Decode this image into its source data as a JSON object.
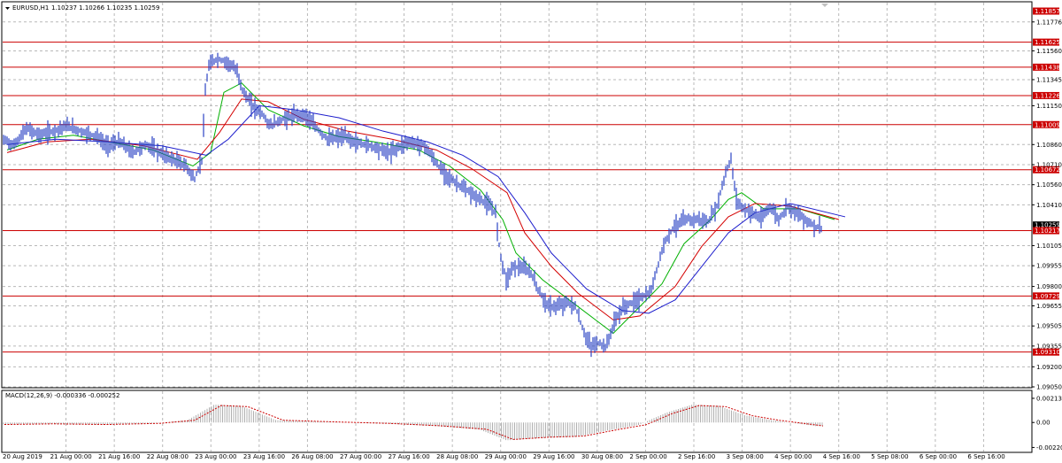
{
  "chart_header": {
    "symbol_timeframe": "EURUSD,H1",
    "ohlc": "1.10237 1.10266 1.10235 1.10259"
  },
  "indicator_header": {
    "label": "MACD(12,26,9) -0.000336 -0.000252"
  },
  "colors": {
    "candles": "#2b44c4",
    "level_lines": "#cc0000",
    "ma_fast": "#00b000",
    "ma_mid": "#d40000",
    "ma_slow": "#1c1ccc",
    "macd_hist": "#b0b0b0",
    "macd_signal": "#cc0000",
    "grid": "#b8b8b8"
  },
  "chart_data": {
    "type": "candlestick",
    "symbol": "EURUSD",
    "timeframe": "H1",
    "ylim": [
      1.0905,
      1.1192
    ],
    "y_ticks": [
      "1.11776",
      "1.11560",
      "1.11345",
      "1.11150",
      "1.10860",
      "1.10710",
      "1.10560",
      "1.10410",
      "1.10105",
      "1.09955",
      "1.09800",
      "1.09655",
      "1.09505",
      "1.09355",
      "1.09200",
      "1.09050"
    ],
    "x_ticks": [
      "20 Aug 2019",
      "21 Aug 00:00",
      "21 Aug 16:00",
      "22 Aug 08:00",
      "23 Aug 00:00",
      "23 Aug 16:00",
      "26 Aug 08:00",
      "27 Aug 00:00",
      "27 Aug 16:00",
      "28 Aug 08:00",
      "29 Aug 00:00",
      "29 Aug 16:00",
      "30 Aug 08:00",
      "2 Sep 00:00",
      "2 Sep 16:00",
      "3 Sep 08:00",
      "4 Sep 00:00",
      "4 Sep 16:00",
      "5 Sep 08:00",
      "6 Sep 00:00",
      "6 Sep 16:00"
    ],
    "levels": [
      {
        "label": "1.11857",
        "value": 1.11857,
        "line": false
      },
      {
        "label": "1.11625",
        "value": 1.11625,
        "line": true
      },
      {
        "label": "1.11438",
        "value": 1.11438,
        "line": true
      },
      {
        "label": "1.11226",
        "value": 1.11226,
        "line": true
      },
      {
        "label": "1.11009",
        "value": 1.11009,
        "line": true
      },
      {
        "label": "1.10672",
        "value": 1.10672,
        "line": true
      },
      {
        "label": "1.10259",
        "value": 1.10259,
        "line": false
      },
      {
        "label": "1.10217",
        "value": 1.10217,
        "line": true
      },
      {
        "label": "1.09729",
        "value": 1.09729,
        "line": true
      },
      {
        "label": "1.09310",
        "value": 1.0931,
        "line": true
      }
    ],
    "price_path": [
      [
        0,
        1.1083
      ],
      [
        5,
        1.109
      ],
      [
        15,
        1.1085
      ],
      [
        30,
        1.1098
      ],
      [
        45,
        1.1093
      ],
      [
        60,
        1.1096
      ],
      [
        75,
        1.11
      ],
      [
        95,
        1.1095
      ],
      [
        110,
        1.1092
      ],
      [
        120,
        1.1085
      ],
      [
        135,
        1.1088
      ],
      [
        150,
        1.108
      ],
      [
        165,
        1.1086
      ],
      [
        180,
        1.108
      ],
      [
        195,
        1.1075
      ],
      [
        210,
        1.107
      ],
      [
        220,
        1.106
      ],
      [
        228,
        1.1075
      ],
      [
        232,
        1.1125
      ],
      [
        236,
        1.1145
      ],
      [
        245,
        1.115
      ],
      [
        255,
        1.1148
      ],
      [
        262,
        1.1145
      ],
      [
        268,
        1.114
      ],
      [
        275,
        1.1125
      ],
      [
        285,
        1.1115
      ],
      [
        295,
        1.111
      ],
      [
        305,
        1.11
      ],
      [
        320,
        1.1105
      ],
      [
        335,
        1.1108
      ],
      [
        345,
        1.1108
      ],
      [
        355,
        1.11
      ],
      [
        370,
        1.109
      ],
      [
        390,
        1.1092
      ],
      [
        400,
        1.1088
      ],
      [
        420,
        1.1085
      ],
      [
        440,
        1.108
      ],
      [
        460,
        1.1088
      ],
      [
        480,
        1.1085
      ],
      [
        495,
        1.107
      ],
      [
        510,
        1.106
      ],
      [
        520,
        1.1055
      ],
      [
        535,
        1.1048
      ],
      [
        550,
        1.1042
      ],
      [
        560,
        1.1035
      ],
      [
        565,
        1.1005
      ],
      [
        572,
        1.0985
      ],
      [
        580,
        1.0995
      ],
      [
        590,
        1.0994
      ],
      [
        600,
        1.099
      ],
      [
        610,
        1.0975
      ],
      [
        620,
        1.0965
      ],
      [
        630,
        1.0965
      ],
      [
        640,
        1.0968
      ],
      [
        650,
        1.0965
      ],
      [
        660,
        1.0945
      ],
      [
        668,
        1.0935
      ],
      [
        675,
        1.0938
      ],
      [
        685,
        1.0935
      ],
      [
        695,
        1.0955
      ],
      [
        705,
        1.0965
      ],
      [
        715,
        1.0968
      ],
      [
        725,
        1.0972
      ],
      [
        735,
        1.0975
      ],
      [
        745,
        1.1
      ],
      [
        752,
        1.1015
      ],
      [
        762,
        1.1025
      ],
      [
        775,
        1.103
      ],
      [
        790,
        1.103
      ],
      [
        800,
        1.1028
      ],
      [
        810,
        1.104
      ],
      [
        820,
        1.1065
      ],
      [
        826,
        1.1075
      ],
      [
        832,
        1.1045
      ],
      [
        840,
        1.1038
      ],
      [
        850,
        1.1035
      ],
      [
        860,
        1.103
      ],
      [
        870,
        1.104
      ],
      [
        880,
        1.103
      ],
      [
        890,
        1.104
      ],
      [
        900,
        1.1035
      ],
      [
        910,
        1.103
      ],
      [
        920,
        1.1025
      ],
      [
        928,
        1.1024
      ]
    ],
    "moving_averages": [
      {
        "color_key": "ma_fast",
        "points": [
          [
            5,
            1.1082
          ],
          [
            40,
            1.109
          ],
          [
            80,
            1.1093
          ],
          [
            120,
            1.1088
          ],
          [
            170,
            1.1082
          ],
          [
            215,
            1.107
          ],
          [
            235,
            1.108
          ],
          [
            250,
            1.1125
          ],
          [
            270,
            1.1132
          ],
          [
            300,
            1.1112
          ],
          [
            340,
            1.11
          ],
          [
            380,
            1.1092
          ],
          [
            420,
            1.1088
          ],
          [
            470,
            1.1082
          ],
          [
            505,
            1.107
          ],
          [
            540,
            1.1052
          ],
          [
            565,
            1.103
          ],
          [
            580,
            1.1005
          ],
          [
            610,
            1.0985
          ],
          [
            640,
            1.097
          ],
          [
            670,
            1.0955
          ],
          [
            690,
            1.0945
          ],
          [
            720,
            1.0965
          ],
          [
            745,
            1.0982
          ],
          [
            770,
            1.1012
          ],
          [
            800,
            1.103
          ],
          [
            820,
            1.1045
          ],
          [
            835,
            1.105
          ],
          [
            860,
            1.1038
          ],
          [
            900,
            1.1038
          ],
          [
            940,
            1.103
          ]
        ]
      },
      {
        "color_key": "ma_mid",
        "points": [
          [
            5,
            1.108
          ],
          [
            50,
            1.1088
          ],
          [
            100,
            1.109
          ],
          [
            160,
            1.1085
          ],
          [
            220,
            1.1075
          ],
          [
            245,
            1.1095
          ],
          [
            270,
            1.112
          ],
          [
            300,
            1.1118
          ],
          [
            340,
            1.1105
          ],
          [
            390,
            1.1096
          ],
          [
            440,
            1.109
          ],
          [
            490,
            1.1082
          ],
          [
            530,
            1.1068
          ],
          [
            570,
            1.105
          ],
          [
            590,
            1.102
          ],
          [
            620,
            1.0995
          ],
          [
            650,
            1.0975
          ],
          [
            690,
            1.0955
          ],
          [
            720,
            1.0958
          ],
          [
            760,
            1.098
          ],
          [
            790,
            1.101
          ],
          [
            820,
            1.1032
          ],
          [
            850,
            1.1042
          ],
          [
            890,
            1.104
          ],
          [
            945,
            1.103
          ]
        ]
      },
      {
        "color_key": "ma_slow",
        "points": [
          [
            5,
            1.1086
          ],
          [
            60,
            1.109
          ],
          [
            120,
            1.1088
          ],
          [
            180,
            1.1085
          ],
          [
            230,
            1.1078
          ],
          [
            255,
            1.109
          ],
          [
            290,
            1.1115
          ],
          [
            330,
            1.1112
          ],
          [
            380,
            1.1106
          ],
          [
            430,
            1.1096
          ],
          [
            480,
            1.1088
          ],
          [
            520,
            1.1078
          ],
          [
            560,
            1.1062
          ],
          [
            590,
            1.1035
          ],
          [
            620,
            1.1005
          ],
          [
            660,
            1.0978
          ],
          [
            700,
            1.0962
          ],
          [
            730,
            1.096
          ],
          [
            760,
            1.097
          ],
          [
            790,
            1.0995
          ],
          [
            820,
            1.102
          ],
          [
            850,
            1.1035
          ],
          [
            890,
            1.1042
          ],
          [
            952,
            1.1032
          ]
        ]
      }
    ],
    "macd": {
      "ylim": [
        -0.00225,
        0.00213
      ],
      "y_ticks": [
        "0.002134",
        "0.00",
        "-0.002205"
      ],
      "signal_path": [
        [
          5,
          -0.00018
        ],
        [
          60,
          -0.00012
        ],
        [
          120,
          -0.00018
        ],
        [
          180,
          -8e-05
        ],
        [
          220,
          0.0002
        ],
        [
          250,
          0.0015
        ],
        [
          280,
          0.0014
        ],
        [
          320,
          0.0002
        ],
        [
          380,
          5e-05
        ],
        [
          440,
          -8e-05
        ],
        [
          500,
          -0.0003
        ],
        [
          550,
          -0.0006
        ],
        [
          580,
          -0.0015
        ],
        [
          620,
          -0.0013
        ],
        [
          660,
          -0.0012
        ],
        [
          700,
          -0.0006
        ],
        [
          730,
          -0.0002
        ],
        [
          760,
          0.0008
        ],
        [
          790,
          0.0015
        ],
        [
          820,
          0.0014
        ],
        [
          850,
          0.0006
        ],
        [
          880,
          0.0002
        ],
        [
          930,
          -0.0003
        ]
      ]
    }
  }
}
